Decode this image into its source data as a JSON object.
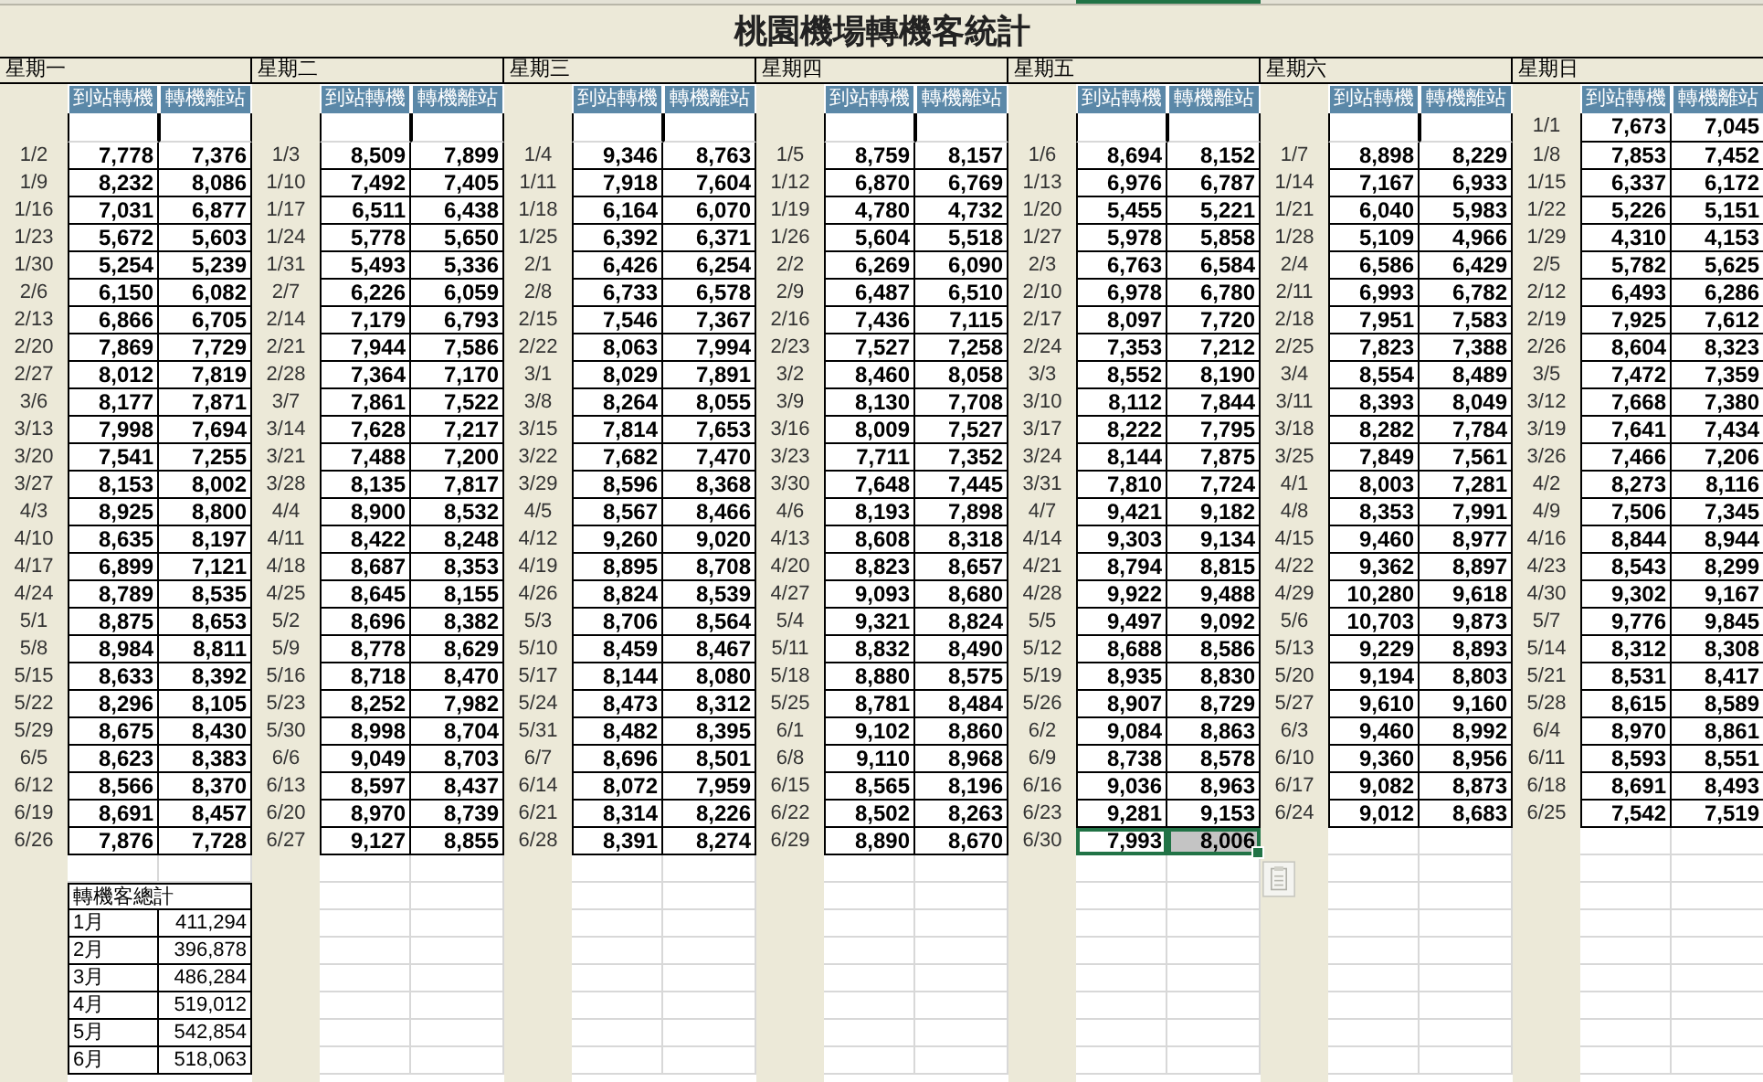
{
  "title": "桃園機場轉機客統計",
  "days": [
    {
      "name": "星期一",
      "columns": [
        "到站轉機",
        "轉機離站"
      ]
    },
    {
      "name": "星期二",
      "columns": [
        "到站轉機",
        "轉機離站"
      ]
    },
    {
      "name": "星期三",
      "columns": [
        "到站轉機",
        "轉機離站"
      ]
    },
    {
      "name": "星期四",
      "columns": [
        "到站轉機",
        "轉機離站"
      ]
    },
    {
      "name": "星期五",
      "columns": [
        "到站轉機",
        "轉機離站"
      ]
    },
    {
      "name": "星期六",
      "columns": [
        "到站轉機",
        "轉機離站"
      ]
    },
    {
      "name": "星期日",
      "columns": [
        "到站轉機",
        "轉機離站"
      ]
    }
  ],
  "weeks": [
    {
      "cells": [
        null,
        null,
        null,
        null,
        null,
        null,
        {
          "date": "1/1",
          "arrive": "7,673",
          "depart": "7,045",
          "selected": false
        }
      ]
    },
    {
      "cells": [
        {
          "date": "1/2",
          "arrive": "7,778",
          "depart": "7,376",
          "selected": false
        },
        {
          "date": "1/3",
          "arrive": "8,509",
          "depart": "7,899",
          "selected": false
        },
        {
          "date": "1/4",
          "arrive": "9,346",
          "depart": "8,763",
          "selected": false
        },
        {
          "date": "1/5",
          "arrive": "8,759",
          "depart": "8,157",
          "selected": false
        },
        {
          "date": "1/6",
          "arrive": "8,694",
          "depart": "8,152",
          "selected": false
        },
        {
          "date": "1/7",
          "arrive": "8,898",
          "depart": "8,229",
          "selected": false
        },
        {
          "date": "1/8",
          "arrive": "7,853",
          "depart": "7,452",
          "selected": false
        }
      ]
    },
    {
      "cells": [
        {
          "date": "1/9",
          "arrive": "8,232",
          "depart": "8,086",
          "selected": false
        },
        {
          "date": "1/10",
          "arrive": "7,492",
          "depart": "7,405",
          "selected": false
        },
        {
          "date": "1/11",
          "arrive": "7,918",
          "depart": "7,604",
          "selected": false
        },
        {
          "date": "1/12",
          "arrive": "6,870",
          "depart": "6,769",
          "selected": false
        },
        {
          "date": "1/13",
          "arrive": "6,976",
          "depart": "6,787",
          "selected": false
        },
        {
          "date": "1/14",
          "arrive": "7,167",
          "depart": "6,933",
          "selected": false
        },
        {
          "date": "1/15",
          "arrive": "6,337",
          "depart": "6,172",
          "selected": false
        }
      ]
    },
    {
      "cells": [
        {
          "date": "1/16",
          "arrive": "7,031",
          "depart": "6,877",
          "selected": false
        },
        {
          "date": "1/17",
          "arrive": "6,511",
          "depart": "6,438",
          "selected": false
        },
        {
          "date": "1/18",
          "arrive": "6,164",
          "depart": "6,070",
          "selected": false
        },
        {
          "date": "1/19",
          "arrive": "4,780",
          "depart": "4,732",
          "selected": false
        },
        {
          "date": "1/20",
          "arrive": "5,455",
          "depart": "5,221",
          "selected": false
        },
        {
          "date": "1/21",
          "arrive": "6,040",
          "depart": "5,983",
          "selected": false
        },
        {
          "date": "1/22",
          "arrive": "5,226",
          "depart": "5,151",
          "selected": false
        }
      ]
    },
    {
      "cells": [
        {
          "date": "1/23",
          "arrive": "5,672",
          "depart": "5,603",
          "selected": false
        },
        {
          "date": "1/24",
          "arrive": "5,778",
          "depart": "5,650",
          "selected": false
        },
        {
          "date": "1/25",
          "arrive": "6,392",
          "depart": "6,371",
          "selected": false
        },
        {
          "date": "1/26",
          "arrive": "5,604",
          "depart": "5,518",
          "selected": false
        },
        {
          "date": "1/27",
          "arrive": "5,978",
          "depart": "5,858",
          "selected": false
        },
        {
          "date": "1/28",
          "arrive": "5,109",
          "depart": "4,966",
          "selected": false
        },
        {
          "date": "1/29",
          "arrive": "4,310",
          "depart": "4,153",
          "selected": false
        }
      ]
    },
    {
      "cells": [
        {
          "date": "1/30",
          "arrive": "5,254",
          "depart": "5,239",
          "selected": false
        },
        {
          "date": "1/31",
          "arrive": "5,493",
          "depart": "5,336",
          "selected": false
        },
        {
          "date": "2/1",
          "arrive": "6,426",
          "depart": "6,254",
          "selected": false
        },
        {
          "date": "2/2",
          "arrive": "6,269",
          "depart": "6,090",
          "selected": false
        },
        {
          "date": "2/3",
          "arrive": "6,763",
          "depart": "6,584",
          "selected": false
        },
        {
          "date": "2/4",
          "arrive": "6,586",
          "depart": "6,429",
          "selected": false
        },
        {
          "date": "2/5",
          "arrive": "5,782",
          "depart": "5,625",
          "selected": false
        }
      ]
    },
    {
      "cells": [
        {
          "date": "2/6",
          "arrive": "6,150",
          "depart": "6,082",
          "selected": false
        },
        {
          "date": "2/7",
          "arrive": "6,226",
          "depart": "6,059",
          "selected": false
        },
        {
          "date": "2/8",
          "arrive": "6,733",
          "depart": "6,578",
          "selected": false
        },
        {
          "date": "2/9",
          "arrive": "6,487",
          "depart": "6,510",
          "selected": false
        },
        {
          "date": "2/10",
          "arrive": "6,978",
          "depart": "6,780",
          "selected": false
        },
        {
          "date": "2/11",
          "arrive": "6,993",
          "depart": "6,782",
          "selected": false
        },
        {
          "date": "2/12",
          "arrive": "6,493",
          "depart": "6,286",
          "selected": false
        }
      ]
    },
    {
      "cells": [
        {
          "date": "2/13",
          "arrive": "6,866",
          "depart": "6,705",
          "selected": false
        },
        {
          "date": "2/14",
          "arrive": "7,179",
          "depart": "6,793",
          "selected": false
        },
        {
          "date": "2/15",
          "arrive": "7,546",
          "depart": "7,367",
          "selected": false
        },
        {
          "date": "2/16",
          "arrive": "7,436",
          "depart": "7,115",
          "selected": false
        },
        {
          "date": "2/17",
          "arrive": "8,097",
          "depart": "7,720",
          "selected": false
        },
        {
          "date": "2/18",
          "arrive": "7,951",
          "depart": "7,583",
          "selected": false
        },
        {
          "date": "2/19",
          "arrive": "7,925",
          "depart": "7,612",
          "selected": false
        }
      ]
    },
    {
      "cells": [
        {
          "date": "2/20",
          "arrive": "7,869",
          "depart": "7,729",
          "selected": false
        },
        {
          "date": "2/21",
          "arrive": "7,944",
          "depart": "7,586",
          "selected": false
        },
        {
          "date": "2/22",
          "arrive": "8,063",
          "depart": "7,994",
          "selected": false
        },
        {
          "date": "2/23",
          "arrive": "7,527",
          "depart": "7,258",
          "selected": false
        },
        {
          "date": "2/24",
          "arrive": "7,353",
          "depart": "7,212",
          "selected": false
        },
        {
          "date": "2/25",
          "arrive": "7,823",
          "depart": "7,388",
          "selected": false
        },
        {
          "date": "2/26",
          "arrive": "8,604",
          "depart": "8,323",
          "selected": false
        }
      ]
    },
    {
      "cells": [
        {
          "date": "2/27",
          "arrive": "8,012",
          "depart": "7,819",
          "selected": false
        },
        {
          "date": "2/28",
          "arrive": "7,364",
          "depart": "7,170",
          "selected": false
        },
        {
          "date": "3/1",
          "arrive": "8,029",
          "depart": "7,891",
          "selected": false
        },
        {
          "date": "3/2",
          "arrive": "8,460",
          "depart": "8,058",
          "selected": false
        },
        {
          "date": "3/3",
          "arrive": "8,552",
          "depart": "8,190",
          "selected": false
        },
        {
          "date": "3/4",
          "arrive": "8,554",
          "depart": "8,489",
          "selected": false
        },
        {
          "date": "3/5",
          "arrive": "7,472",
          "depart": "7,359",
          "selected": false
        }
      ]
    },
    {
      "cells": [
        {
          "date": "3/6",
          "arrive": "8,177",
          "depart": "7,871",
          "selected": false
        },
        {
          "date": "3/7",
          "arrive": "7,861",
          "depart": "7,522",
          "selected": false
        },
        {
          "date": "3/8",
          "arrive": "8,264",
          "depart": "8,055",
          "selected": false
        },
        {
          "date": "3/9",
          "arrive": "8,130",
          "depart": "7,708",
          "selected": false
        },
        {
          "date": "3/10",
          "arrive": "8,112",
          "depart": "7,844",
          "selected": false
        },
        {
          "date": "3/11",
          "arrive": "8,393",
          "depart": "8,049",
          "selected": false
        },
        {
          "date": "3/12",
          "arrive": "7,668",
          "depart": "7,380",
          "selected": false
        }
      ]
    },
    {
      "cells": [
        {
          "date": "3/13",
          "arrive": "7,998",
          "depart": "7,694",
          "selected": false
        },
        {
          "date": "3/14",
          "arrive": "7,628",
          "depart": "7,217",
          "selected": false
        },
        {
          "date": "3/15",
          "arrive": "7,814",
          "depart": "7,653",
          "selected": false
        },
        {
          "date": "3/16",
          "arrive": "8,009",
          "depart": "7,527",
          "selected": false
        },
        {
          "date": "3/17",
          "arrive": "8,222",
          "depart": "7,795",
          "selected": false
        },
        {
          "date": "3/18",
          "arrive": "8,282",
          "depart": "7,784",
          "selected": false
        },
        {
          "date": "3/19",
          "arrive": "7,641",
          "depart": "7,434",
          "selected": false
        }
      ]
    },
    {
      "cells": [
        {
          "date": "3/20",
          "arrive": "7,541",
          "depart": "7,255",
          "selected": false
        },
        {
          "date": "3/21",
          "arrive": "7,488",
          "depart": "7,200",
          "selected": false
        },
        {
          "date": "3/22",
          "arrive": "7,682",
          "depart": "7,470",
          "selected": false
        },
        {
          "date": "3/23",
          "arrive": "7,711",
          "depart": "7,352",
          "selected": false
        },
        {
          "date": "3/24",
          "arrive": "8,144",
          "depart": "7,875",
          "selected": false
        },
        {
          "date": "3/25",
          "arrive": "7,849",
          "depart": "7,561",
          "selected": false
        },
        {
          "date": "3/26",
          "arrive": "7,466",
          "depart": "7,206",
          "selected": false
        }
      ]
    },
    {
      "cells": [
        {
          "date": "3/27",
          "arrive": "8,153",
          "depart": "8,002",
          "selected": false
        },
        {
          "date": "3/28",
          "arrive": "8,135",
          "depart": "7,817",
          "selected": false
        },
        {
          "date": "3/29",
          "arrive": "8,596",
          "depart": "8,368",
          "selected": false
        },
        {
          "date": "3/30",
          "arrive": "7,648",
          "depart": "7,445",
          "selected": false
        },
        {
          "date": "3/31",
          "arrive": "7,810",
          "depart": "7,724",
          "selected": false
        },
        {
          "date": "4/1",
          "arrive": "8,003",
          "depart": "7,281",
          "selected": false
        },
        {
          "date": "4/2",
          "arrive": "8,273",
          "depart": "8,116",
          "selected": false
        }
      ]
    },
    {
      "cells": [
        {
          "date": "4/3",
          "arrive": "8,925",
          "depart": "8,800",
          "selected": false
        },
        {
          "date": "4/4",
          "arrive": "8,900",
          "depart": "8,532",
          "selected": false
        },
        {
          "date": "4/5",
          "arrive": "8,567",
          "depart": "8,466",
          "selected": false
        },
        {
          "date": "4/6",
          "arrive": "8,193",
          "depart": "7,898",
          "selected": false
        },
        {
          "date": "4/7",
          "arrive": "9,421",
          "depart": "9,182",
          "selected": false
        },
        {
          "date": "4/8",
          "arrive": "8,353",
          "depart": "7,991",
          "selected": false
        },
        {
          "date": "4/9",
          "arrive": "7,506",
          "depart": "7,345",
          "selected": false
        }
      ]
    },
    {
      "cells": [
        {
          "date": "4/10",
          "arrive": "8,635",
          "depart": "8,197",
          "selected": false
        },
        {
          "date": "4/11",
          "arrive": "8,422",
          "depart": "8,248",
          "selected": false
        },
        {
          "date": "4/12",
          "arrive": "9,260",
          "depart": "9,020",
          "selected": false
        },
        {
          "date": "4/13",
          "arrive": "8,608",
          "depart": "8,318",
          "selected": false
        },
        {
          "date": "4/14",
          "arrive": "9,303",
          "depart": "9,134",
          "selected": false
        },
        {
          "date": "4/15",
          "arrive": "9,460",
          "depart": "8,977",
          "selected": false
        },
        {
          "date": "4/16",
          "arrive": "8,844",
          "depart": "8,944",
          "selected": false
        }
      ]
    },
    {
      "cells": [
        {
          "date": "4/17",
          "arrive": "6,899",
          "depart": "7,121",
          "selected": false
        },
        {
          "date": "4/18",
          "arrive": "8,687",
          "depart": "8,353",
          "selected": false
        },
        {
          "date": "4/19",
          "arrive": "8,895",
          "depart": "8,708",
          "selected": false
        },
        {
          "date": "4/20",
          "arrive": "8,823",
          "depart": "8,657",
          "selected": false
        },
        {
          "date": "4/21",
          "arrive": "8,794",
          "depart": "8,815",
          "selected": false
        },
        {
          "date": "4/22",
          "arrive": "9,362",
          "depart": "8,897",
          "selected": false
        },
        {
          "date": "4/23",
          "arrive": "8,543",
          "depart": "8,299",
          "selected": false
        }
      ]
    },
    {
      "cells": [
        {
          "date": "4/24",
          "arrive": "8,789",
          "depart": "8,535",
          "selected": false
        },
        {
          "date": "4/25",
          "arrive": "8,645",
          "depart": "8,155",
          "selected": false
        },
        {
          "date": "4/26",
          "arrive": "8,824",
          "depart": "8,539",
          "selected": false
        },
        {
          "date": "4/27",
          "arrive": "9,093",
          "depart": "8,680",
          "selected": false
        },
        {
          "date": "4/28",
          "arrive": "9,922",
          "depart": "9,488",
          "selected": false
        },
        {
          "date": "4/29",
          "arrive": "10,280",
          "depart": "9,618",
          "selected": false
        },
        {
          "date": "4/30",
          "arrive": "9,302",
          "depart": "9,167",
          "selected": false
        }
      ]
    },
    {
      "cells": [
        {
          "date": "5/1",
          "arrive": "8,875",
          "depart": "8,653",
          "selected": false
        },
        {
          "date": "5/2",
          "arrive": "8,696",
          "depart": "8,382",
          "selected": false
        },
        {
          "date": "5/3",
          "arrive": "8,706",
          "depart": "8,564",
          "selected": false
        },
        {
          "date": "5/4",
          "arrive": "9,321",
          "depart": "8,824",
          "selected": false
        },
        {
          "date": "5/5",
          "arrive": "9,497",
          "depart": "9,092",
          "selected": false
        },
        {
          "date": "5/6",
          "arrive": "10,703",
          "depart": "9,873",
          "selected": false
        },
        {
          "date": "5/7",
          "arrive": "9,776",
          "depart": "9,845",
          "selected": false
        }
      ]
    },
    {
      "cells": [
        {
          "date": "5/8",
          "arrive": "8,984",
          "depart": "8,811",
          "selected": false
        },
        {
          "date": "5/9",
          "arrive": "8,778",
          "depart": "8,629",
          "selected": false
        },
        {
          "date": "5/10",
          "arrive": "8,459",
          "depart": "8,467",
          "selected": false
        },
        {
          "date": "5/11",
          "arrive": "8,832",
          "depart": "8,490",
          "selected": false
        },
        {
          "date": "5/12",
          "arrive": "8,688",
          "depart": "8,586",
          "selected": false
        },
        {
          "date": "5/13",
          "arrive": "9,229",
          "depart": "8,893",
          "selected": false
        },
        {
          "date": "5/14",
          "arrive": "8,312",
          "depart": "8,308",
          "selected": false
        }
      ]
    },
    {
      "cells": [
        {
          "date": "5/15",
          "arrive": "8,633",
          "depart": "8,392",
          "selected": false
        },
        {
          "date": "5/16",
          "arrive": "8,718",
          "depart": "8,470",
          "selected": false
        },
        {
          "date": "5/17",
          "arrive": "8,144",
          "depart": "8,080",
          "selected": false
        },
        {
          "date": "5/18",
          "arrive": "8,880",
          "depart": "8,575",
          "selected": false
        },
        {
          "date": "5/19",
          "arrive": "8,935",
          "depart": "8,830",
          "selected": false
        },
        {
          "date": "5/20",
          "arrive": "9,194",
          "depart": "8,803",
          "selected": false
        },
        {
          "date": "5/21",
          "arrive": "8,531",
          "depart": "8,417",
          "selected": false
        }
      ]
    },
    {
      "cells": [
        {
          "date": "5/22",
          "arrive": "8,296",
          "depart": "8,105",
          "selected": false
        },
        {
          "date": "5/23",
          "arrive": "8,252",
          "depart": "7,982",
          "selected": false
        },
        {
          "date": "5/24",
          "arrive": "8,473",
          "depart": "8,312",
          "selected": false
        },
        {
          "date": "5/25",
          "arrive": "8,781",
          "depart": "8,484",
          "selected": false
        },
        {
          "date": "5/26",
          "arrive": "8,907",
          "depart": "8,729",
          "selected": false
        },
        {
          "date": "5/27",
          "arrive": "9,610",
          "depart": "9,160",
          "selected": false
        },
        {
          "date": "5/28",
          "arrive": "8,615",
          "depart": "8,589",
          "selected": false
        }
      ]
    },
    {
      "cells": [
        {
          "date": "5/29",
          "arrive": "8,675",
          "depart": "8,430",
          "selected": false
        },
        {
          "date": "5/30",
          "arrive": "8,998",
          "depart": "8,704",
          "selected": false
        },
        {
          "date": "5/31",
          "arrive": "8,482",
          "depart": "8,395",
          "selected": false
        },
        {
          "date": "6/1",
          "arrive": "9,102",
          "depart": "8,860",
          "selected": false
        },
        {
          "date": "6/2",
          "arrive": "9,084",
          "depart": "8,863",
          "selected": false
        },
        {
          "date": "6/3",
          "arrive": "9,460",
          "depart": "8,992",
          "selected": false
        },
        {
          "date": "6/4",
          "arrive": "8,970",
          "depart": "8,861",
          "selected": false
        }
      ]
    },
    {
      "cells": [
        {
          "date": "6/5",
          "arrive": "8,623",
          "depart": "8,383",
          "selected": false
        },
        {
          "date": "6/6",
          "arrive": "9,049",
          "depart": "8,703",
          "selected": false
        },
        {
          "date": "6/7",
          "arrive": "8,696",
          "depart": "8,501",
          "selected": false
        },
        {
          "date": "6/8",
          "arrive": "9,110",
          "depart": "8,968",
          "selected": false
        },
        {
          "date": "6/9",
          "arrive": "8,738",
          "depart": "8,578",
          "selected": false
        },
        {
          "date": "6/10",
          "arrive": "9,360",
          "depart": "8,956",
          "selected": false
        },
        {
          "date": "6/11",
          "arrive": "8,593",
          "depart": "8,551",
          "selected": false
        }
      ]
    },
    {
      "cells": [
        {
          "date": "6/12",
          "arrive": "8,566",
          "depart": "8,370",
          "selected": false
        },
        {
          "date": "6/13",
          "arrive": "8,597",
          "depart": "8,437",
          "selected": false
        },
        {
          "date": "6/14",
          "arrive": "8,072",
          "depart": "7,959",
          "selected": false
        },
        {
          "date": "6/15",
          "arrive": "8,565",
          "depart": "8,196",
          "selected": false
        },
        {
          "date": "6/16",
          "arrive": "9,036",
          "depart": "8,963",
          "selected": false
        },
        {
          "date": "6/17",
          "arrive": "9,082",
          "depart": "8,873",
          "selected": false
        },
        {
          "date": "6/18",
          "arrive": "8,691",
          "depart": "8,493",
          "selected": false
        }
      ]
    },
    {
      "cells": [
        {
          "date": "6/19",
          "arrive": "8,691",
          "depart": "8,457",
          "selected": false
        },
        {
          "date": "6/20",
          "arrive": "8,970",
          "depart": "8,739",
          "selected": false
        },
        {
          "date": "6/21",
          "arrive": "8,314",
          "depart": "8,226",
          "selected": false
        },
        {
          "date": "6/22",
          "arrive": "8,502",
          "depart": "8,263",
          "selected": false
        },
        {
          "date": "6/23",
          "arrive": "9,281",
          "depart": "9,153",
          "selected": false
        },
        {
          "date": "6/24",
          "arrive": "9,012",
          "depart": "8,683",
          "selected": false
        },
        {
          "date": "6/25",
          "arrive": "7,542",
          "depart": "7,519",
          "selected": false
        }
      ]
    },
    {
      "cells": [
        {
          "date": "6/26",
          "arrive": "7,876",
          "depart": "7,728",
          "selected": false
        },
        {
          "date": "6/27",
          "arrive": "9,127",
          "depart": "8,855",
          "selected": false
        },
        {
          "date": "6/28",
          "arrive": "8,391",
          "depart": "8,274",
          "selected": false
        },
        {
          "date": "6/29",
          "arrive": "8,890",
          "depart": "8,670",
          "selected": false
        },
        {
          "date": "6/30",
          "arrive": "7,993",
          "depart": "8,006",
          "selected": true
        },
        null,
        null
      ]
    }
  ],
  "summary": {
    "title": "轉機客總計",
    "rows": [
      {
        "month": "1月",
        "total": "411,294"
      },
      {
        "month": "2月",
        "total": "396,878"
      },
      {
        "month": "3月",
        "total": "486,284"
      },
      {
        "month": "4月",
        "total": "519,012"
      },
      {
        "month": "5月",
        "total": "542,854"
      },
      {
        "month": "6月",
        "total": "518,063"
      }
    ]
  }
}
